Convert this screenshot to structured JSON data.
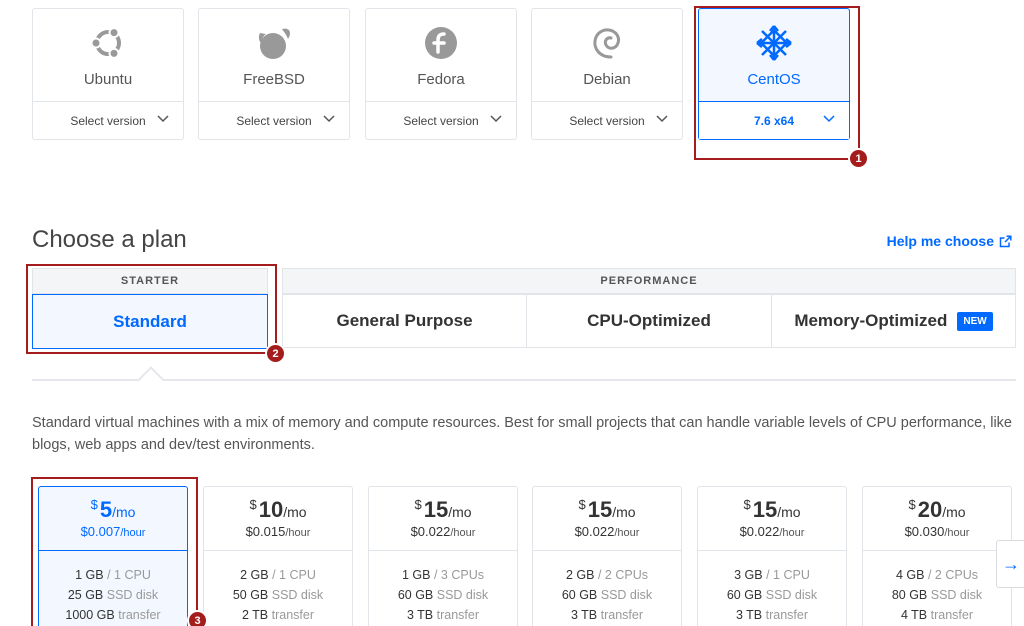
{
  "os_options": [
    {
      "name": "Ubuntu",
      "version": "Select version",
      "icon": "ubuntu-icon",
      "selected": false
    },
    {
      "name": "FreeBSD",
      "version": "Select version",
      "icon": "freebsd-icon",
      "selected": false
    },
    {
      "name": "Fedora",
      "version": "Select version",
      "icon": "fedora-icon",
      "selected": false
    },
    {
      "name": "Debian",
      "version": "Select version",
      "icon": "debian-icon",
      "selected": false
    },
    {
      "name": "CentOS",
      "version": "7.6 x64",
      "icon": "centos-icon",
      "selected": true
    }
  ],
  "annotations": [
    "1",
    "2",
    "3"
  ],
  "plan_section": {
    "title": "Choose a plan",
    "help_link": "Help me choose",
    "groups": {
      "starter": "STARTER",
      "performance": "PERFORMANCE"
    },
    "tabs": {
      "standard": "Standard",
      "general_purpose": "General Purpose",
      "cpu_optimized": "CPU-Optimized",
      "memory_optimized": "Memory-Optimized",
      "new_badge": "NEW"
    },
    "description": "Standard virtual machines with a mix of memory and compute resources. Best for small projects that can handle variable levels of CPU performance, like blogs, web apps and dev/test environments."
  },
  "currency": "$",
  "per_month": "/mo",
  "per_hour": "/hour",
  "plans": [
    {
      "price": "5",
      "hourly": "$0.007",
      "mem": "1 GB",
      "cpu": "/ 1 CPU",
      "disk": "25 GB",
      "disk_label": "SSD disk",
      "transfer": "1000 GB",
      "transfer_label": "transfer",
      "selected": true
    },
    {
      "price": "10",
      "hourly": "$0.015",
      "mem": "2 GB",
      "cpu": "/ 1 CPU",
      "disk": "50 GB",
      "disk_label": "SSD disk",
      "transfer": "2 TB",
      "transfer_label": "transfer",
      "selected": false
    },
    {
      "price": "15",
      "hourly": "$0.022",
      "mem": "1 GB",
      "cpu": "/ 3 CPUs",
      "disk": "60 GB",
      "disk_label": "SSD disk",
      "transfer": "3 TB",
      "transfer_label": "transfer",
      "selected": false
    },
    {
      "price": "15",
      "hourly": "$0.022",
      "mem": "2 GB",
      "cpu": "/ 2 CPUs",
      "disk": "60 GB",
      "disk_label": "SSD disk",
      "transfer": "3 TB",
      "transfer_label": "transfer",
      "selected": false
    },
    {
      "price": "15",
      "hourly": "$0.022",
      "mem": "3 GB",
      "cpu": "/ 1 CPU",
      "disk": "60 GB",
      "disk_label": "SSD disk",
      "transfer": "3 TB",
      "transfer_label": "transfer",
      "selected": false
    },
    {
      "price": "20",
      "hourly": "$0.030",
      "mem": "4 GB",
      "cpu": "/ 2 CPUs",
      "disk": "80 GB",
      "disk_label": "SSD disk",
      "transfer": "4 TB",
      "transfer_label": "transfer",
      "selected": false
    }
  ],
  "next_arrow": "→",
  "colors": {
    "accent": "#0069ff",
    "annotation": "#a51c1c",
    "border": "#e1e4e8"
  }
}
